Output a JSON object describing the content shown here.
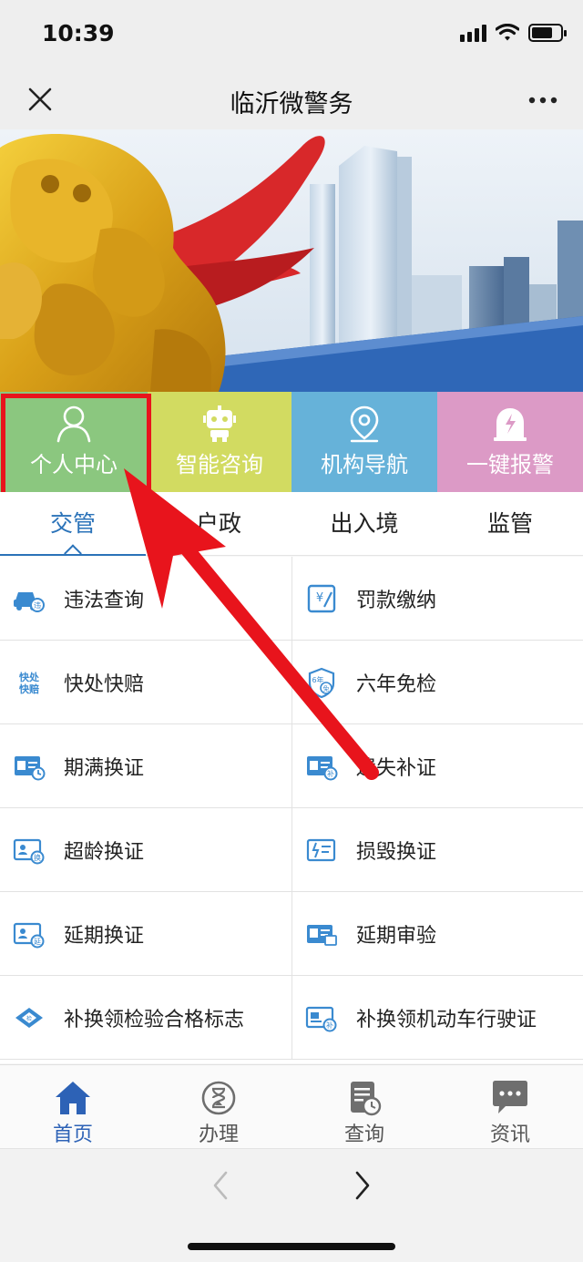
{
  "status_bar": {
    "time": "10:39"
  },
  "nav": {
    "title": "临沂微警务",
    "close_icon": "close-icon",
    "more_icon": "more-icon"
  },
  "quick_tiles": [
    {
      "label": "个人中心",
      "icon": "user-icon",
      "color": "#8bc77f"
    },
    {
      "label": "智能咨询",
      "icon": "robot-icon",
      "color": "#d2db61"
    },
    {
      "label": "机构导航",
      "icon": "location-pin-icon",
      "color": "#66b2d9"
    },
    {
      "label": "一键报警",
      "icon": "alarm-icon",
      "color": "#dc9ac6"
    }
  ],
  "tabs": [
    {
      "label": "交管",
      "active": true
    },
    {
      "label": "户政",
      "active": false
    },
    {
      "label": "出入境",
      "active": false
    },
    {
      "label": "监管",
      "active": false
    }
  ],
  "services": [
    {
      "label": "违法查询",
      "icon": "car-violation-icon"
    },
    {
      "label": "罚款缴纳",
      "icon": "fine-payment-icon"
    },
    {
      "label": "快处快赔",
      "icon": "quick-claim-icon"
    },
    {
      "label": "六年免检",
      "icon": "inspection-exempt-icon"
    },
    {
      "label": "期满换证",
      "icon": "license-renew-icon"
    },
    {
      "label": "遗失补证",
      "icon": "license-lost-icon"
    },
    {
      "label": "超龄换证",
      "icon": "license-overage-icon"
    },
    {
      "label": "损毁换证",
      "icon": "license-damaged-icon"
    },
    {
      "label": "延期换证",
      "icon": "license-extend-icon"
    },
    {
      "label": "延期审验",
      "icon": "review-extend-icon"
    },
    {
      "label": "补换领检验合格标志",
      "icon": "inspection-mark-icon"
    },
    {
      "label": "补换领机动车行驶证",
      "icon": "vehicle-license-icon"
    }
  ],
  "bottom_tabs": [
    {
      "label": "首页",
      "icon": "home-icon",
      "active": true
    },
    {
      "label": "办理",
      "icon": "hourglass-icon",
      "active": false
    },
    {
      "label": "查询",
      "icon": "document-clock-icon",
      "active": false
    },
    {
      "label": "资讯",
      "icon": "chat-icon",
      "active": false
    }
  ],
  "colors": {
    "accent": "#2b73b9",
    "highlight": "#e8141c",
    "arrow": "#e8141c"
  }
}
